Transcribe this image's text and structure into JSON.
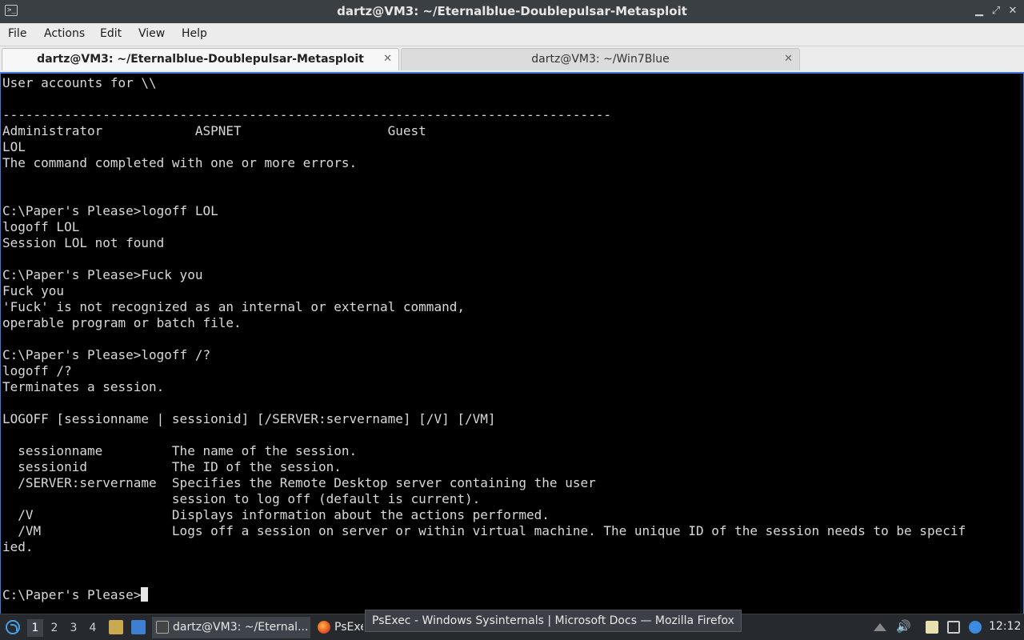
{
  "window": {
    "title": "dartz@VM3: ~/Eternalblue-Doublepulsar-Metasploit",
    "app_icon_glyph": ">_",
    "controls": {
      "minimize": "▁",
      "maximize": "⤢",
      "close": "✕"
    }
  },
  "menu": {
    "items": [
      "File",
      "Actions",
      "Edit",
      "View",
      "Help"
    ]
  },
  "tabs": [
    {
      "label": "dartz@VM3: ~/Eternalblue-Doublepulsar-Metasploit",
      "active": true,
      "close": "✕"
    },
    {
      "label": "dartz@VM3: ~/Win7Blue",
      "active": false,
      "close": "✕"
    }
  ],
  "terminal": {
    "lines": [
      "User accounts for \\\\",
      "",
      "-------------------------------------------------------------------------------",
      "Administrator            ASPNET                   Guest",
      "LOL",
      "The command completed with one or more errors.",
      "",
      "",
      "C:\\Paper's Please>logoff LOL",
      "logoff LOL",
      "Session LOL not found",
      "",
      "C:\\Paper's Please>Fuck you",
      "Fuck you",
      "'Fuck' is not recognized as an internal or external command,",
      "operable program or batch file.",
      "",
      "C:\\Paper's Please>logoff /?",
      "logoff /?",
      "Terminates a session.",
      "",
      "LOGOFF [sessionname | sessionid] [/SERVER:servername] [/V] [/VM]",
      "",
      "  sessionname         The name of the session.",
      "  sessionid           The ID of the session.",
      "  /SERVER:servername  Specifies the Remote Desktop server containing the user",
      "                      session to log off (default is current).",
      "  /V                  Displays information about the actions performed.",
      "  /VM                 Logs off a session on server or within virtual machine. The unique ID of the session needs to be specif",
      "ied.",
      "",
      ""
    ],
    "prompt": "C:\\Paper's Please>"
  },
  "taskbar": {
    "workspaces": [
      "1",
      "2",
      "3",
      "4"
    ],
    "active_workspace": "1",
    "tasks": [
      {
        "label": "dartz@VM3: ~/Eternal...",
        "icon": "terminal-icon"
      },
      {
        "label": "PsExec",
        "icon": "firefox-icon"
      }
    ],
    "tooltip": "PsExec - Windows Sysinternals | Microsoft Docs — Mozilla Firefox",
    "clock": "12:12",
    "tray_icons": [
      "show-hidden-icon",
      "volume-icon",
      "clipboard-icon",
      "network-icon",
      "update-icon"
    ]
  },
  "colors": {
    "terminal_bg": "#000000",
    "terminal_fg": "#d8d8d8",
    "accent": "#3d7bd9",
    "titlebar_bg": "#3a3f44",
    "taskbar_bg": "#262a2e"
  }
}
